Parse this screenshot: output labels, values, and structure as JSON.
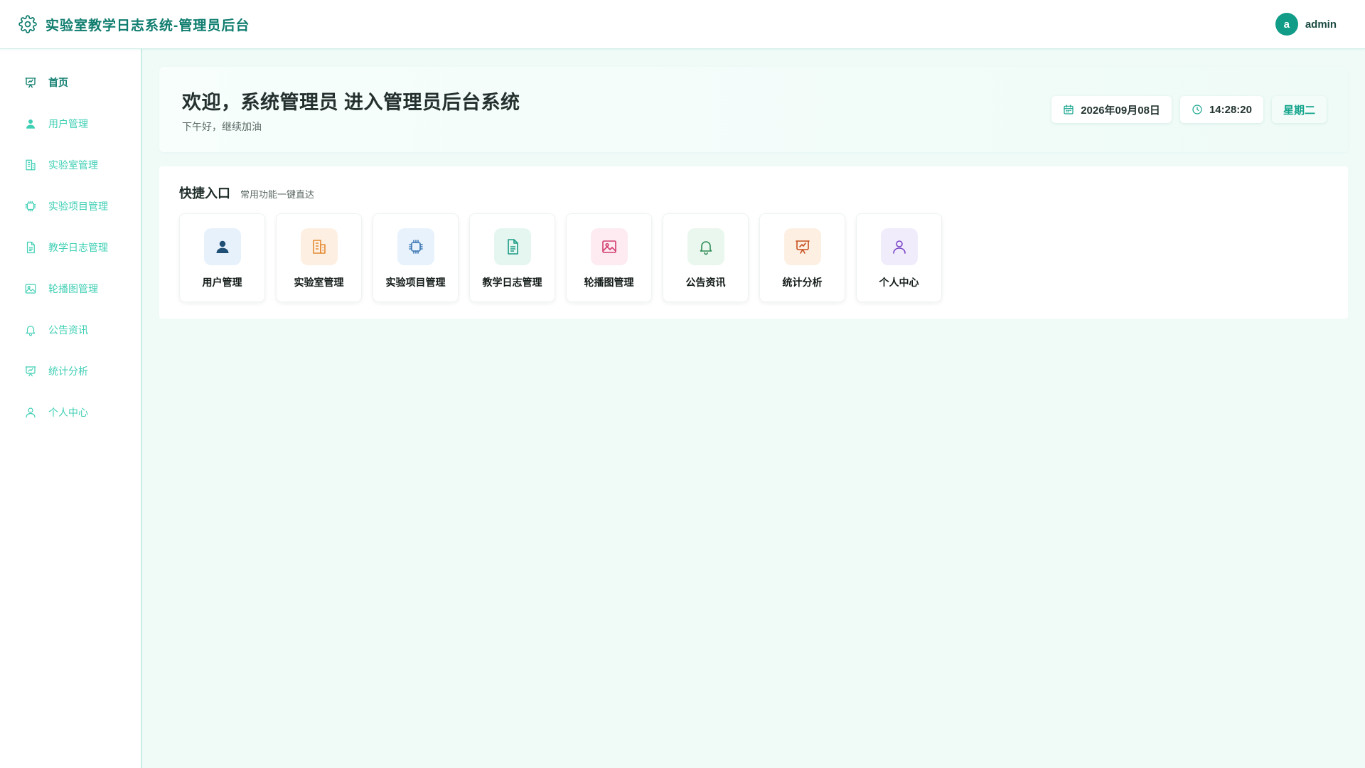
{
  "header": {
    "title": "实验室教学日志系统-管理员后台",
    "avatar_letter": "a",
    "username": "admin"
  },
  "sidebar": {
    "items": [
      {
        "label": "首页",
        "icon": "presentation-chart-icon",
        "active": true
      },
      {
        "label": "用户管理",
        "icon": "user-icon",
        "active": false
      },
      {
        "label": "实验室管理",
        "icon": "building-icon",
        "active": false
      },
      {
        "label": "实验项目管理",
        "icon": "chip-icon",
        "active": false
      },
      {
        "label": "教学日志管理",
        "icon": "document-icon",
        "active": false
      },
      {
        "label": "轮播图管理",
        "icon": "image-icon",
        "active": false
      },
      {
        "label": "公告资讯",
        "icon": "bell-icon",
        "active": false
      },
      {
        "label": "统计分析",
        "icon": "presentation-chart-icon",
        "active": false
      },
      {
        "label": "个人中心",
        "icon": "user-outline-icon",
        "active": false
      }
    ]
  },
  "welcome": {
    "title": "欢迎，系统管理员 进入管理员后台系统",
    "subtitle": "下午好，继续加油",
    "date": "2026年09月08日",
    "time": "14:28:20",
    "weekday": "星期二"
  },
  "quick_access": {
    "title": "快捷入口",
    "subtitle": "常用功能一键直达",
    "cards": [
      {
        "label": "用户管理",
        "icon": "user-icon",
        "bg": "#e6f1fb",
        "color": "#1f4f74"
      },
      {
        "label": "实验室管理",
        "icon": "building-icon",
        "bg": "#fdf0e3",
        "color": "#e48a33"
      },
      {
        "label": "实验项目管理",
        "icon": "chip-icon",
        "bg": "#e8f2fc",
        "color": "#3b77b4"
      },
      {
        "label": "教学日志管理",
        "icon": "document-icon",
        "bg": "#e5f6f1",
        "color": "#1b9b85"
      },
      {
        "label": "轮播图管理",
        "icon": "image-icon",
        "bg": "#fdebf1",
        "color": "#d23c70"
      },
      {
        "label": "公告资讯",
        "icon": "bell-icon",
        "bg": "#eaf7ee",
        "color": "#2f8c55"
      },
      {
        "label": "统计分析",
        "icon": "presentation-chart-icon",
        "bg": "#fdf0e3",
        "color": "#c8501f"
      },
      {
        "label": "个人中心",
        "icon": "user-outline-icon",
        "bg": "#f1ecfb",
        "color": "#7a45c8"
      }
    ]
  },
  "colors": {
    "brand": "#0f7d6f",
    "sidebar_text": "#3fcfb4",
    "background": "#f0fbf8"
  }
}
